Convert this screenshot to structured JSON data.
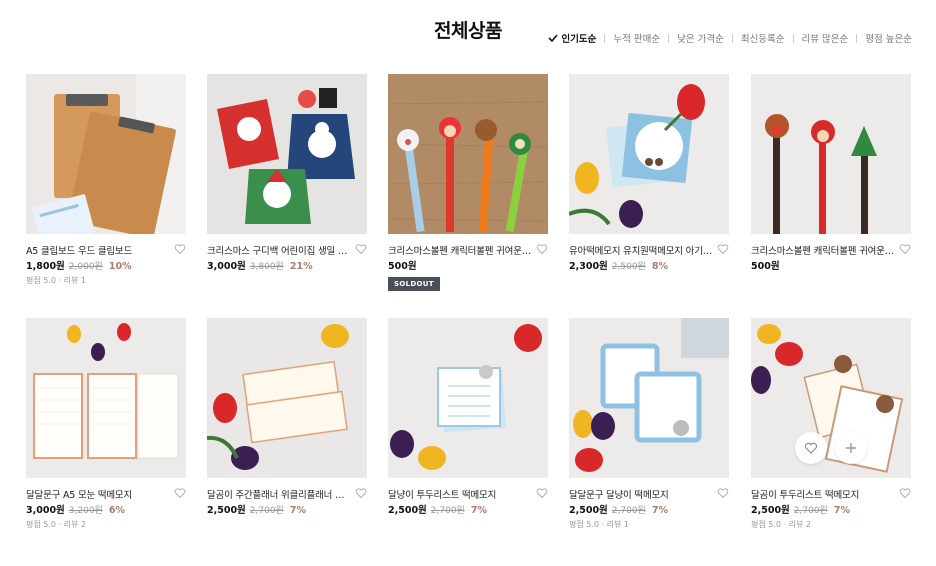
{
  "page": {
    "title": "전체상품"
  },
  "sort": {
    "options": [
      "인기도순",
      "누적 판매순",
      "낮은 가격순",
      "최신등록순",
      "리뷰 많은순",
      "평점 높은순"
    ],
    "active": "인기도순"
  },
  "products": [
    {
      "name": "A5 클립보드 우드 클립보드",
      "price": "1,800원",
      "original": "2,000원",
      "discount": "10%",
      "rating": "평점 5.0 · 리뷰 1",
      "thumb": "clipboard"
    },
    {
      "name": "크리스마스 구디백 어린이집 생일 답례품",
      "price": "3,000원",
      "original": "3,800원",
      "discount": "21%",
      "thumb": "xmasbag"
    },
    {
      "name": "크리스마스볼펜 캐릭터볼펜 귀여운볼펜",
      "price": "500원",
      "badge": "SOLDOUT",
      "thumb": "pens-a"
    },
    {
      "name": "유아떡메모지 유치원떡메모지 아기떡메모지",
      "price": "2,300원",
      "original": "2,500원",
      "discount": "8%",
      "thumb": "memo-blue"
    },
    {
      "name": "크리스마스볼펜 캐릭터볼펜 귀여운볼펜",
      "price": "500원",
      "thumb": "pens-b"
    },
    {
      "name": "달달문구 A5 모눈 떡메모지",
      "price": "3,000원",
      "original": "3,200원",
      "discount": "6%",
      "rating": "평점 5.0 · 리뷰 2",
      "thumb": "grid-memo"
    },
    {
      "name": "달곰이 주간플래너 위클리플래너 일정표",
      "price": "2,500원",
      "original": "2,700원",
      "discount": "7%",
      "thumb": "planner"
    },
    {
      "name": "달냥이 투두리스트 떡메모지",
      "price": "2,500원",
      "original": "2,700원",
      "discount": "7%",
      "thumb": "todo-cat"
    },
    {
      "name": "달달문구 달냥이 떡메모지",
      "price": "2,500원",
      "original": "2,700원",
      "discount": "7%",
      "rating": "평점 5.0 · 리뷰 1",
      "thumb": "cat-memo"
    },
    {
      "name": "달곰이 투두리스트 떡메모지",
      "price": "2,500원",
      "original": "2,700원",
      "discount": "7%",
      "rating": "평점 5.0 · 리뷰 2",
      "thumb": "bear-todo"
    }
  ],
  "hover_actions": {
    "icons": [
      "heart-outline-icon",
      "plus-icon"
    ]
  },
  "colors": {
    "discount": "#a97c6a",
    "soldout_bg": "#4a4f57",
    "text": "#222222"
  }
}
